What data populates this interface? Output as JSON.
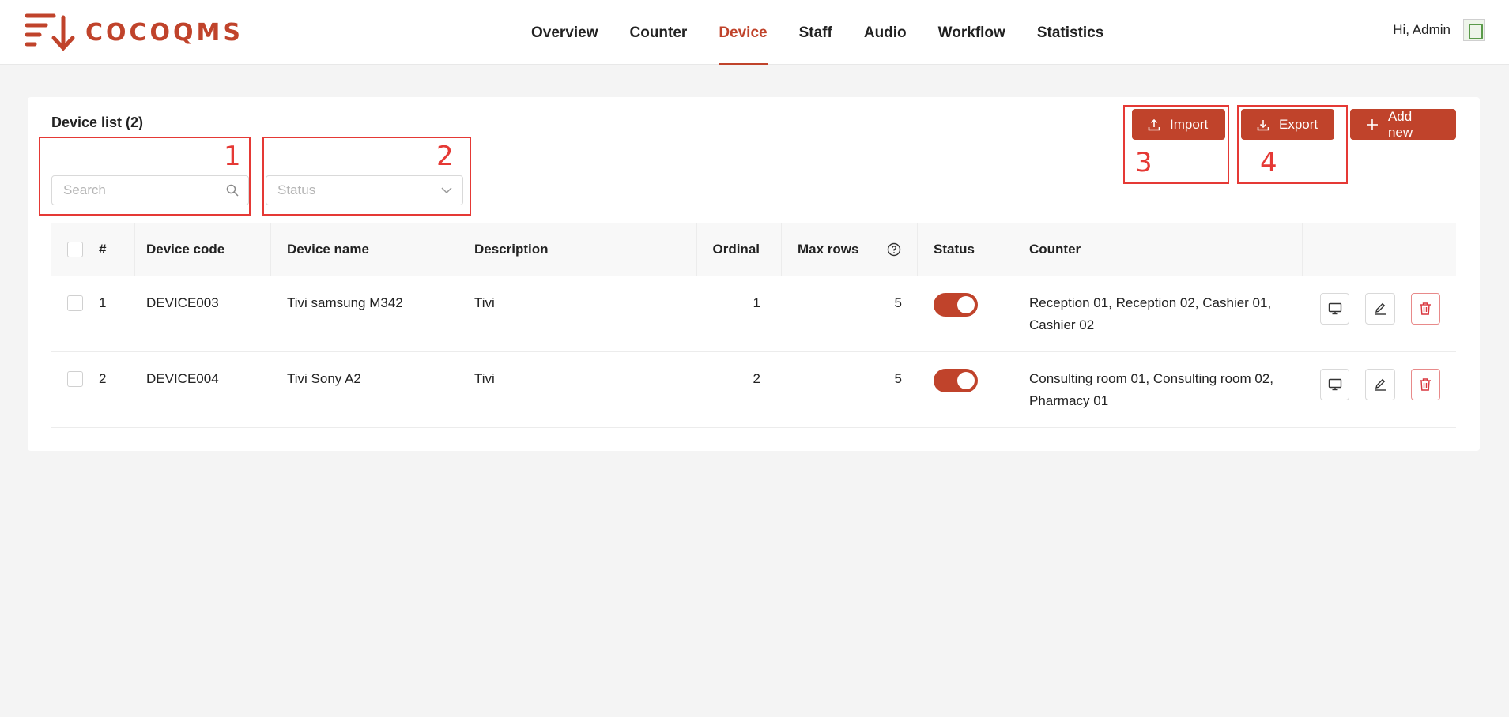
{
  "brand": {
    "name": "COCOQMS",
    "color": "#c0432b"
  },
  "nav": [
    {
      "label": "Overview",
      "active": false
    },
    {
      "label": "Counter",
      "active": false
    },
    {
      "label": "Device",
      "active": true
    },
    {
      "label": "Staff",
      "active": false
    },
    {
      "label": "Audio",
      "active": false
    },
    {
      "label": "Workflow",
      "active": false
    },
    {
      "label": "Statistics",
      "active": false
    }
  ],
  "user": {
    "greeting": "Hi, Admin"
  },
  "card": {
    "title": "Device list (2)",
    "buttons": {
      "import": "Import",
      "export": "Export",
      "add": "Add new"
    },
    "search": {
      "placeholder": "Search"
    },
    "status_filter": {
      "placeholder": "Status"
    }
  },
  "table": {
    "headers": {
      "num": "#",
      "code": "Device code",
      "name": "Device name",
      "description": "Description",
      "ordinal": "Ordinal",
      "max_rows": "Max rows",
      "status": "Status",
      "counter": "Counter"
    },
    "rows": [
      {
        "num": "1",
        "code": "DEVICE003",
        "name": "Tivi samsung M342",
        "description": "Tivi",
        "ordinal": "1",
        "max_rows": "5",
        "status": true,
        "counter": "Reception 01, Reception 02, Cashier 01, Cashier 02"
      },
      {
        "num": "2",
        "code": "DEVICE004",
        "name": "Tivi Sony A2",
        "description": "Tivi",
        "ordinal": "2",
        "max_rows": "5",
        "status": true,
        "counter": "Consulting room 01, Consulting room 02, Pharmacy 01"
      }
    ]
  },
  "annotations": [
    "1",
    "2",
    "3",
    "4"
  ],
  "icons": {
    "logo": "queue-arrow-icon",
    "search": "search-icon",
    "status": "chevron-down-icon",
    "import": "upload-icon",
    "export": "download-icon",
    "add": "plus-icon",
    "help": "help-circle-icon",
    "monitor": "monitor-icon",
    "edit": "edit-icon",
    "delete": "trash-icon"
  }
}
